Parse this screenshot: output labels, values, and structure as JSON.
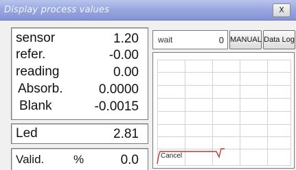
{
  "window": {
    "title": "Display process values",
    "close_label": "X"
  },
  "values": [
    {
      "label": "sensor",
      "value": "1.20"
    },
    {
      "label": "refer.",
      "value": "-0.00"
    },
    {
      "label": "reading",
      "value": "0.00"
    },
    {
      "label": "Absorb.",
      "value": "0.0000"
    },
    {
      "label": "Blank",
      "value": "-0.0015"
    }
  ],
  "led": {
    "label": "Led",
    "value": "2.81"
  },
  "valid": {
    "label": "Valid.",
    "unit": "%",
    "value": "0.0"
  },
  "status": {
    "text": "wait",
    "count": "0"
  },
  "buttons": {
    "manual": "MANUAL",
    "datalog": "Data Log"
  },
  "graph": {
    "cancel_label": "Cancel",
    "line_color": "#c0392b"
  }
}
